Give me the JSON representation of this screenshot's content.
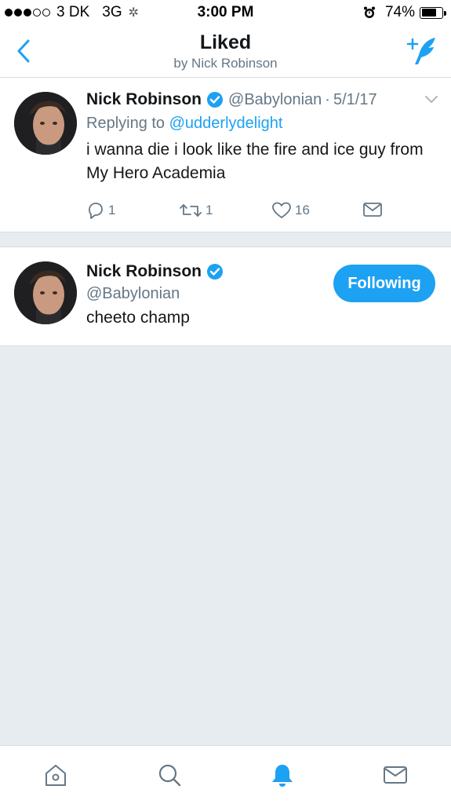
{
  "status_bar": {
    "carrier": "3 DK",
    "network": "3G",
    "time": "3:00 PM",
    "battery": "74%",
    "battery_level": 0.74,
    "signal_bars_filled": 3,
    "signal_bars_total": 5
  },
  "nav": {
    "title": "Liked",
    "subtitle": "by Nick Robinson",
    "back_icon": "chevron-left-icon",
    "compose_icon": "compose-feather-icon"
  },
  "tweet": {
    "name": "Nick Robinson",
    "handle": "@Babylonian",
    "separator": "·",
    "date": "5/1/17",
    "replying_prefix": "Replying to",
    "replying_to": "@udderlydelight",
    "text": "i wanna die i look like the fire and ice guy from My Hero Academia",
    "reply_count": "1",
    "retweet_count": "1",
    "like_count": "16"
  },
  "user_card": {
    "name": "Nick Robinson",
    "handle": "@Babylonian",
    "bio": "cheeto champ",
    "follow_label": "Following"
  },
  "colors": {
    "accent": "#1da1f2",
    "text_primary": "#14171a",
    "text_secondary": "#657786",
    "background": "#e6ecf0"
  },
  "tab_bar": {
    "tabs": [
      "home-icon",
      "search-icon",
      "notifications-icon",
      "messages-icon"
    ],
    "active": "notifications-icon"
  }
}
